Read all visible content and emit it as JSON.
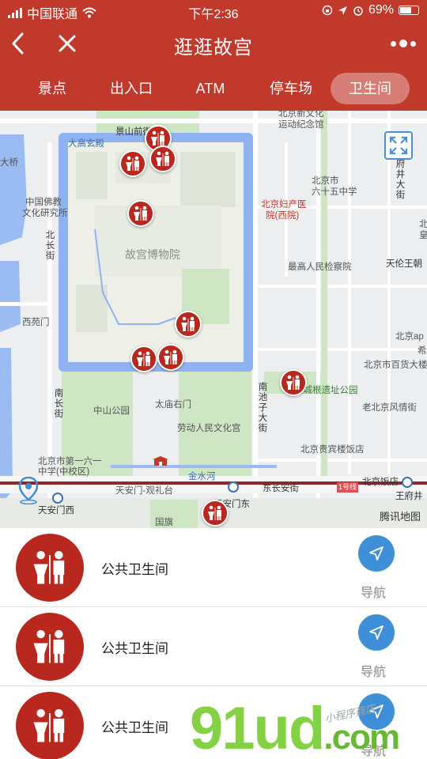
{
  "status_bar": {
    "carrier": "中国联通",
    "time": "下午2:36",
    "battery": "69%",
    "battery_level": 0.69
  },
  "nav": {
    "title": "逛逛故宫"
  },
  "tabs": [
    {
      "label": "景点",
      "active": false
    },
    {
      "label": "出入口",
      "active": false
    },
    {
      "label": "ATM",
      "active": false
    },
    {
      "label": "停车场",
      "active": false
    },
    {
      "label": "卫生间",
      "active": true
    }
  ],
  "map": {
    "provider": "腾讯地图",
    "labels": {
      "jingshan": "景山前街",
      "daqiaoxuan": "大高玄殿",
      "daqiao": "大桥",
      "fojiao": "中国佛教",
      "wenhua": "文化研究所",
      "beichang": "北长街",
      "palace": "故宫博物院",
      "xiyuan": "西苑门",
      "nanchang": "南长街",
      "zhongshan": "中山公园",
      "taimiao": "太庙右门",
      "laodong": "劳动人民文化宫",
      "school1": "北京市第一六一",
      "school2": "中学(中校区)",
      "tiananmen_guan": "天安门-观礼台",
      "jinshuihe": "金水河",
      "tiananmen_w": "天安门西",
      "tiananmen_e": "天安门东",
      "guoqi": "国旗",
      "dongchangan": "东长安街",
      "line1": "1号线",
      "beijinfan": "北京饭店",
      "wangfujing": "王府井",
      "guibin": "北京贵宾楼饭店",
      "huangcheng": "皇城根遗址公园",
      "laobeijing": "老北京风情街",
      "baihuo": "北京市百货大楼",
      "beijingapp": "北京ap",
      "xi": "希",
      "tianlun": "天伦王朝",
      "beijing_right": "北京",
      "huang_right": "皇",
      "nanchizi": "南池子大街",
      "gaojian": "最高人民检察院",
      "fuchan1": "北京妇产医",
      "fuchan2": "院(西院)",
      "school651": "北京市",
      "school652": "六十五中学",
      "xinwenhua1": "北京新文化",
      "xinwenhua2": "运动纪念馆",
      "fujing": "府井大街"
    }
  },
  "list": {
    "items": [
      {
        "name": "公共卫生间",
        "nav_label": "导航"
      },
      {
        "name": "公共卫生间",
        "nav_label": "导航"
      },
      {
        "name": "公共卫生间",
        "nav_label": "导航"
      }
    ]
  },
  "watermark": {
    "main": "91ud",
    "dot": ".com",
    "sub": "小程序商店"
  },
  "colors": {
    "brand_red": "#c0392b",
    "pin_red": "#b8281e",
    "nav_blue": "#3f8fd8",
    "moat_blue": "#8fb3f0",
    "park_green": "#cfe6c4"
  }
}
